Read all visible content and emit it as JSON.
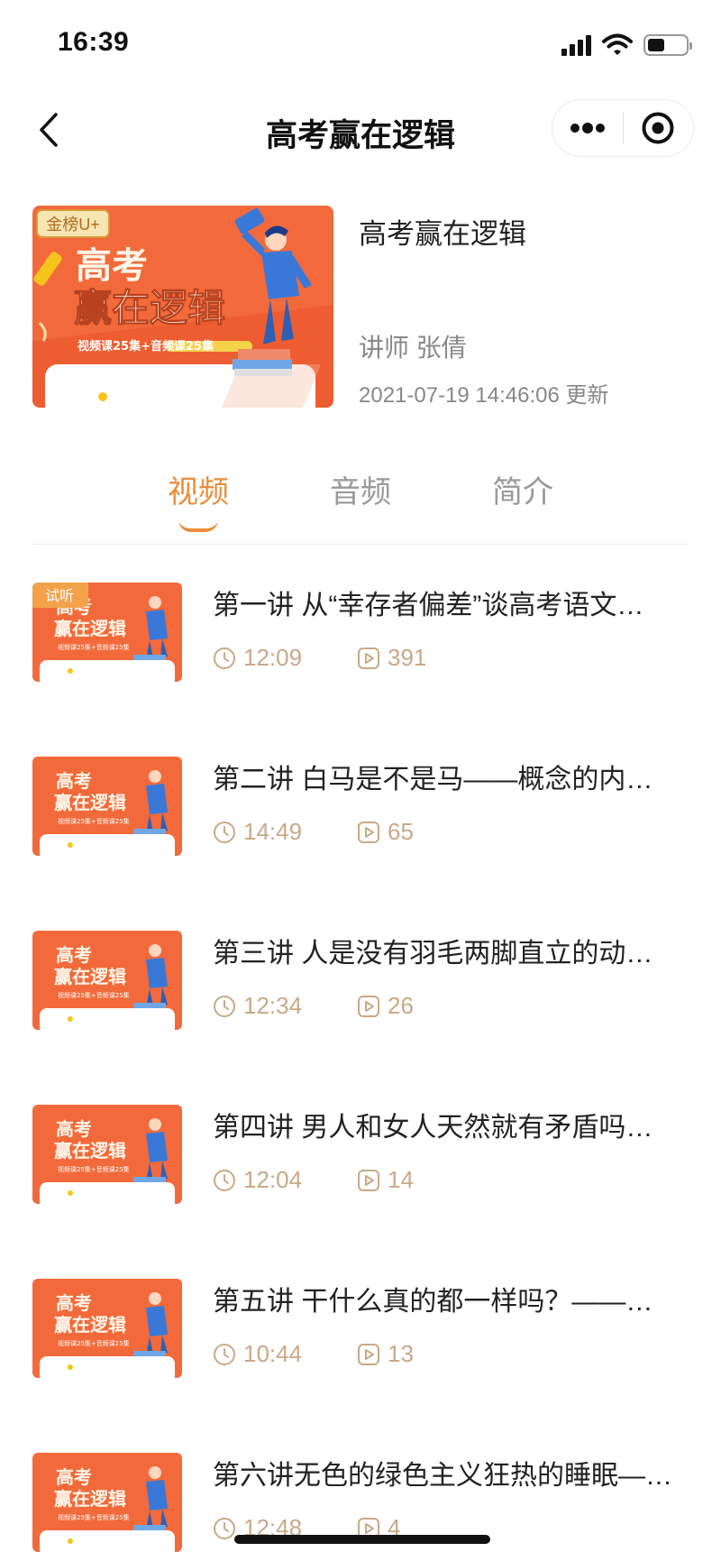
{
  "status_bar": {
    "time": "16:39",
    "icons": [
      "signal-icon",
      "wifi-icon",
      "battery-icon"
    ]
  },
  "nav": {
    "title": "高考赢在逻辑",
    "icons": [
      "back-icon",
      "more-icon",
      "close-icon"
    ]
  },
  "course": {
    "title": "高考赢在逻辑",
    "teacher": "讲师 张倩",
    "updated": "2021-07-19 14:46:06 更新",
    "cover": {
      "badge": "金榜U+",
      "headline_1": "高考",
      "headline_2": "赢在逻辑",
      "subline": "视频课25集+音频课25集"
    }
  },
  "tabs": [
    {
      "label": "视频",
      "active": true
    },
    {
      "label": "音频",
      "active": false
    },
    {
      "label": "简介",
      "active": false
    }
  ],
  "lessons": [
    {
      "title": "第一讲 从“幸存者偏差”谈高考语文…",
      "duration": "12:09",
      "views": "391",
      "badge": "试听"
    },
    {
      "title": "第二讲 白马是不是马——概念的内…",
      "duration": "14:49",
      "views": "65"
    },
    {
      "title": "第三讲 人是没有羽毛两脚直立的动…",
      "duration": "12:34",
      "views": "26"
    },
    {
      "title": "第四讲 男人和女人天然就有矛盾吗…",
      "duration": "12:04",
      "views": "14"
    },
    {
      "title": "第五讲 干什么真的都一样吗？——…",
      "duration": "10:44",
      "views": "13"
    },
    {
      "title": "第六讲无色的绿色主义狂热的睡眠—…",
      "duration": "12:48",
      "views": "4"
    }
  ],
  "thumb_text": {
    "headline_1": "高考",
    "headline_2": "赢在逻辑",
    "subline": "视频课25集+音频课25集"
  },
  "colors": {
    "accent": "#ed8c3a",
    "cover_orange": "#f26a3b",
    "figure_blue": "#3a78d8",
    "meta": "#c8a987",
    "muted": "#888888"
  }
}
